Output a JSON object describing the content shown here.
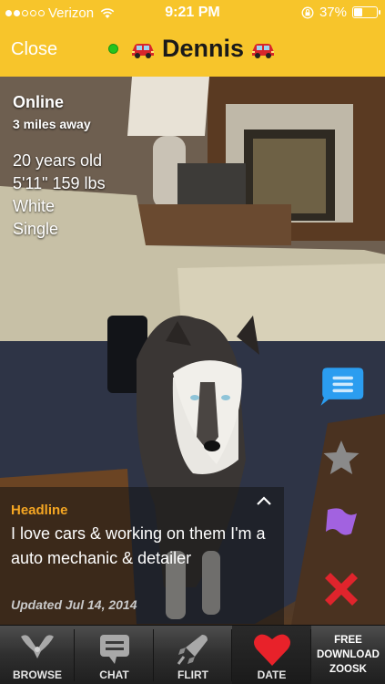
{
  "status_bar": {
    "carrier": "Verizon",
    "time": "9:21 PM",
    "battery_percent": "37%",
    "battery_level": 0.37
  },
  "nav": {
    "close_label": "Close",
    "title": "Dennis",
    "online_color": "#26c41d",
    "header_color": "#f7c52b"
  },
  "profile": {
    "status": "Online",
    "distance": "3 miles away",
    "facts": [
      "20 years old",
      "5'11\" 159 lbs",
      "White",
      "Single"
    ]
  },
  "headline": {
    "label": "Headline",
    "text": "I love cars & working on them I'm a auto mechanic & detailer",
    "updated": "Updated Jul 14, 2014"
  },
  "actions": [
    {
      "name": "chat-bubble-icon",
      "color": "#2b9df0"
    },
    {
      "name": "star-icon",
      "color": "#8a8a8a"
    },
    {
      "name": "flag-icon",
      "color": "#a262e0"
    },
    {
      "name": "x-icon",
      "color": "#e0242c"
    }
  ],
  "tabs": [
    {
      "label": "BROWSE",
      "icon": "browse-icon"
    },
    {
      "label": "CHAT",
      "icon": "chat-icon"
    },
    {
      "label": "FLIRT",
      "icon": "rocket-icon"
    },
    {
      "label": "DATE",
      "icon": "heart-icon"
    }
  ],
  "promo": {
    "line1": "FREE",
    "line2": "DOWNLOAD",
    "line3": "ZOOSK"
  }
}
